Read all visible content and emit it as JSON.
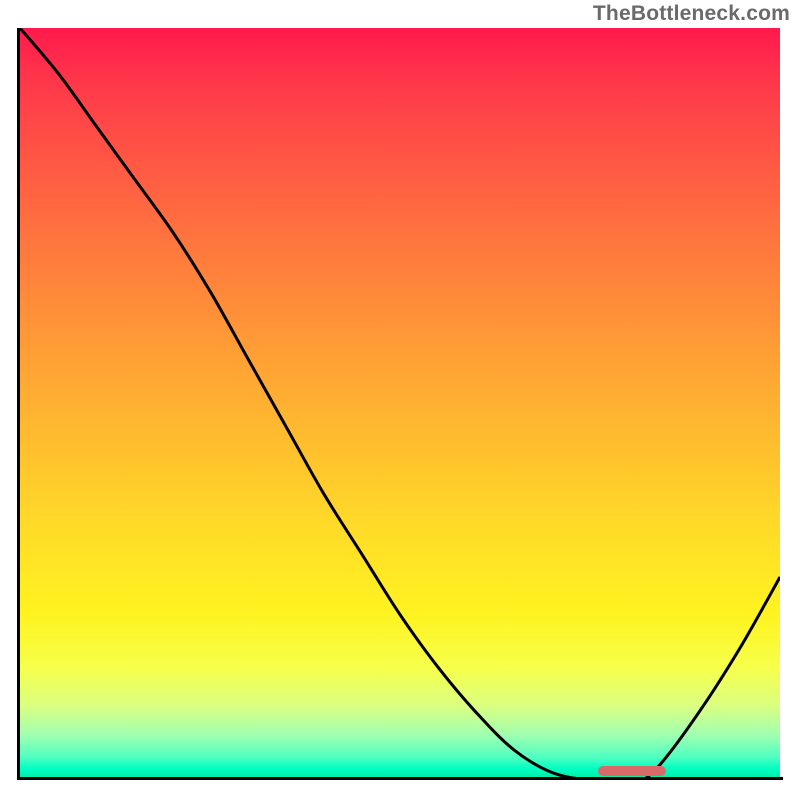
{
  "watermark": "TheBottleneck.com",
  "colors": {
    "axis": "#000000",
    "curve": "#000000",
    "marker": "#d96a6a",
    "gradient_top": "#ff1a4d",
    "gradient_bottom": "#00e8a0"
  },
  "chart_data": {
    "type": "line",
    "title": "",
    "xlabel": "",
    "ylabel": "",
    "xlim": [
      0,
      100
    ],
    "ylim": [
      0,
      100
    ],
    "grid": false,
    "legend": false,
    "x": [
      0,
      5,
      10,
      15,
      20,
      25,
      30,
      35,
      40,
      45,
      50,
      55,
      60,
      65,
      70,
      75,
      80,
      82,
      85,
      90,
      95,
      100
    ],
    "values": [
      100,
      94,
      87,
      80,
      73,
      65,
      56,
      47,
      38,
      30,
      22,
      15,
      9,
      4,
      1,
      0,
      0,
      0,
      3,
      10,
      18,
      27
    ],
    "flat_region": {
      "x_start": 75,
      "x_end": 82,
      "value": 0
    },
    "marker": {
      "x_start": 76,
      "x_end": 85
    }
  }
}
